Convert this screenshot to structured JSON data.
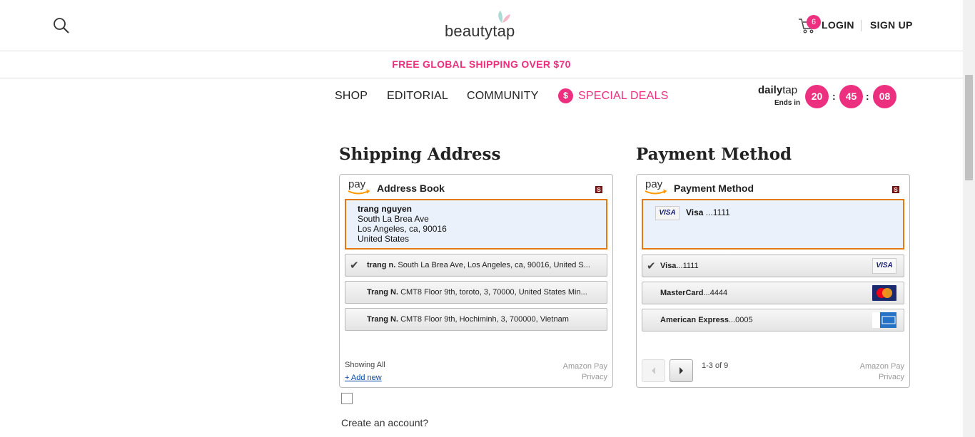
{
  "header": {
    "logo_text": "beautytap",
    "cart_count": "6",
    "login_label": "LOGIN",
    "signup_label": "SIGN UP"
  },
  "promo": {
    "text": "FREE GLOBAL SHIPPING OVER $70"
  },
  "nav": {
    "items": [
      "SHOP",
      "EDITORIAL",
      "COMMUNITY"
    ],
    "deals_icon": "$",
    "deals_label": "SPECIAL DEALS"
  },
  "dailytap": {
    "logo_bold": "daily",
    "logo_light": "tap",
    "ends_in": "Ends in",
    "hours": "20",
    "minutes": "45",
    "seconds": "08",
    "sep": ":"
  },
  "shipping": {
    "section_title": "Shipping Address",
    "widget_title": "Address Book",
    "pay_text": "pay",
    "s_badge": "S",
    "selected": {
      "name": "trang nguyen",
      "line1": "South La Brea Ave",
      "line2": "Los Angeles, ca, 90016",
      "line3": "United States"
    },
    "options": [
      {
        "check": "✔",
        "name": "trang n.",
        "address": "South La Brea Ave, Los Angeles, ca, 90016, United S..."
      },
      {
        "check": "",
        "name": "Trang N.",
        "address": "CMT8 Floor 9th, toroto, 3, 70000, United States Min..."
      },
      {
        "check": "",
        "name": "Trang N.",
        "address": "CMT8 Floor 9th, Hochiminh, 3, 700000, Vietnam"
      }
    ],
    "showing": "Showing All",
    "add_new": "+ Add new",
    "amazon_pay": "Amazon Pay",
    "privacy": "Privacy"
  },
  "payment": {
    "section_title": "Payment Method",
    "widget_title": "Payment Method",
    "pay_text": "pay",
    "s_badge": "S",
    "selected": {
      "logo": "VISA",
      "brand": "Visa",
      "digits": " ...1111"
    },
    "options": [
      {
        "check": "✔",
        "brand": "Visa",
        "digits": "...1111",
        "logo": "VISA",
        "logo_icon": "visa-card-icon"
      },
      {
        "check": "",
        "brand": "MasterCard",
        "digits": "...4444",
        "logo": "",
        "logo_icon": "mastercard-icon"
      },
      {
        "check": "",
        "brand": "American Express",
        "digits": "...0005",
        "logo": "",
        "logo_icon": "amex-card-icon"
      }
    ],
    "pager_text": "1-3 of 9",
    "amazon_pay": "Amazon Pay",
    "privacy": "Privacy"
  },
  "create_account": "Create an account?",
  "colors": {
    "brand_pink": "#ec2f7f",
    "amazon_orange": "#e47911"
  }
}
